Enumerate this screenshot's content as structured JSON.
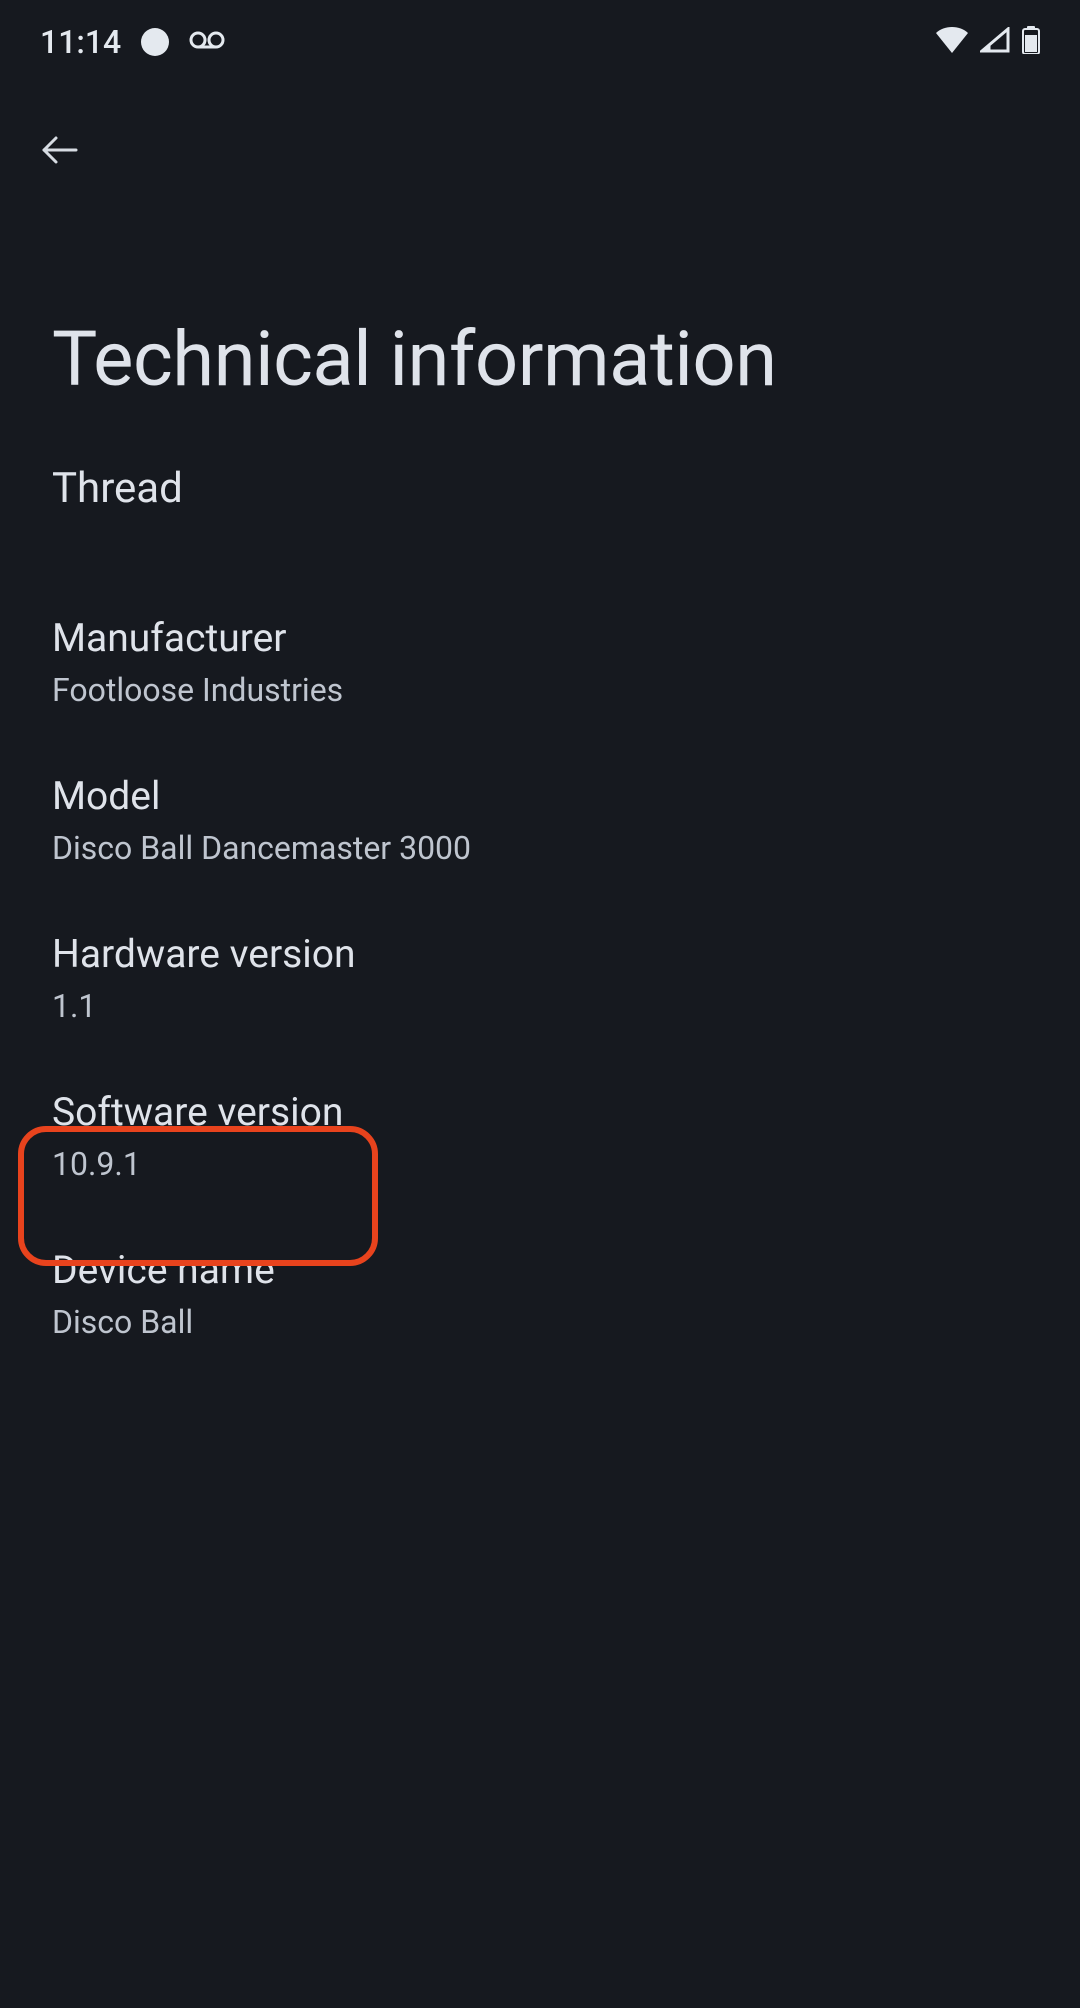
{
  "statusBar": {
    "time": "11:14"
  },
  "page": {
    "title": "Technical information",
    "subtitle": "Thread"
  },
  "info": {
    "manufacturer": {
      "label": "Manufacturer",
      "value": "Footloose Industries"
    },
    "model": {
      "label": "Model",
      "value": "Disco Ball Dancemaster 3000"
    },
    "hardwareVersion": {
      "label": "Hardware version",
      "value": "1.1"
    },
    "softwareVersion": {
      "label": "Software version",
      "value": "10.9.1"
    },
    "deviceName": {
      "label": "Device name",
      "value": "Disco Ball"
    }
  }
}
